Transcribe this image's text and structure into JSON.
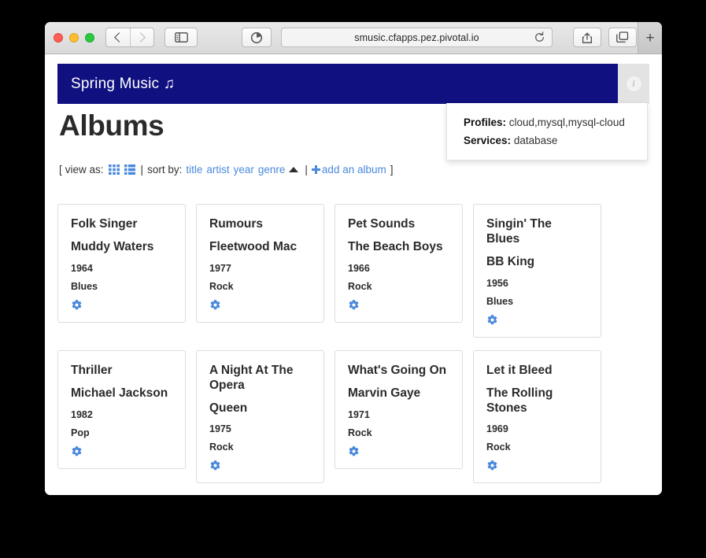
{
  "browser": {
    "url": "smusic.cfapps.pez.pivotal.io",
    "back_icon": "back-chevron-icon",
    "forward_icon": "forward-chevron-icon",
    "sidebar_icon": "sidebar-icon",
    "cloud_tabs_icon": "icloud-tabs-icon",
    "reload_icon": "reload-icon",
    "share_icon": "share-icon",
    "tabs_icon": "show-tabs-icon",
    "new_tab_label": "+"
  },
  "app": {
    "brand": "Spring Music ♫",
    "brand_color": "#101080",
    "info_icon_label": "i"
  },
  "popover": {
    "profiles_label": "Profiles:",
    "profiles_value": "cloud,mysql,mysql-cloud",
    "services_label": "Services:",
    "services_value": "database"
  },
  "page": {
    "heading": "Albums",
    "controls": {
      "open_bracket": "[",
      "view_as_label": "view as:",
      "grid_icon": "grid-view-icon",
      "list_icon": "list-view-icon",
      "pipe1": "|",
      "sort_by_label": "sort by:",
      "sort_title": "title",
      "sort_artist": "artist",
      "sort_year": "year",
      "sort_genre": "genre",
      "sort_direction_icon": "caret-up-icon",
      "pipe2": "|",
      "add_album_label": "add an album",
      "close_bracket": "]"
    }
  },
  "albums": [
    {
      "title": "Folk Singer",
      "artist": "Muddy Waters",
      "year": "1964",
      "genre": "Blues"
    },
    {
      "title": "Rumours",
      "artist": "Fleetwood Mac",
      "year": "1977",
      "genre": "Rock"
    },
    {
      "title": "Pet Sounds",
      "artist": "The Beach Boys",
      "year": "1966",
      "genre": "Rock"
    },
    {
      "title": "Singin' The Blues",
      "artist": "BB King",
      "year": "1956",
      "genre": "Blues"
    },
    {
      "title": "Thriller",
      "artist": "Michael Jackson",
      "year": "1982",
      "genre": "Pop"
    },
    {
      "title": "A Night At The Opera",
      "artist": "Queen",
      "year": "1975",
      "genre": "Rock"
    },
    {
      "title": "What's Going On",
      "artist": "Marvin Gaye",
      "year": "1971",
      "genre": "Rock"
    },
    {
      "title": "Let it Bleed",
      "artist": "The Rolling Stones",
      "year": "1969",
      "genre": "Rock"
    }
  ],
  "colors": {
    "accent_link": "#4a89dc",
    "header_navy": "#101080",
    "card_border": "#dcdcdc"
  }
}
